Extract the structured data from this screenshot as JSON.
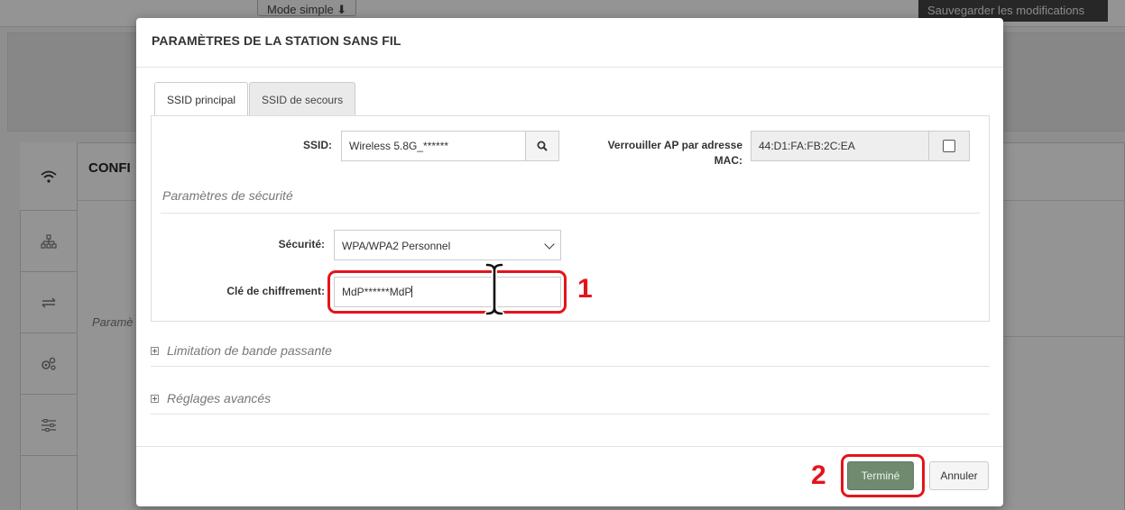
{
  "background": {
    "mode_button": "Mode simple ⬇",
    "save_button": "Sauvegarder les modifications",
    "config_title": "CONFI",
    "param_label": "Paramè"
  },
  "modal": {
    "title": "PARAMÈTRES DE LA STATION SANS FIL",
    "tabs": [
      {
        "label": "SSID principal",
        "active": true
      },
      {
        "label": "SSID de secours",
        "active": false
      }
    ],
    "ssid": {
      "label": "SSID:",
      "value": "Wireless 5.8G_******"
    },
    "lock_ap": {
      "label_line1": "Verrouiller AP par adresse",
      "label_line2": "MAC:",
      "value": "44:D1:FA:FB:2C:EA",
      "checked": false
    },
    "security_section": "Paramètres de sécurité",
    "security": {
      "label": "Sécurité:",
      "value": "WPA/WPA2 Personnel"
    },
    "key": {
      "label": "Clé de chiffrement:",
      "value": "MdP******MdP"
    },
    "bandwidth_section": "Limitation de bande passante",
    "advanced_section": "Réglages avancés",
    "done_button": "Terminé",
    "cancel_button": "Annuler"
  },
  "annotations": {
    "step1": "1",
    "step2": "2",
    "color": "#e4141b"
  },
  "icons": [
    "wifi-icon",
    "network-icon",
    "transfer-icon",
    "gears-icon",
    "sliders-icon",
    "search-icon",
    "chevron-down-icon",
    "plus-square-icon",
    "text-cursor-icon"
  ]
}
